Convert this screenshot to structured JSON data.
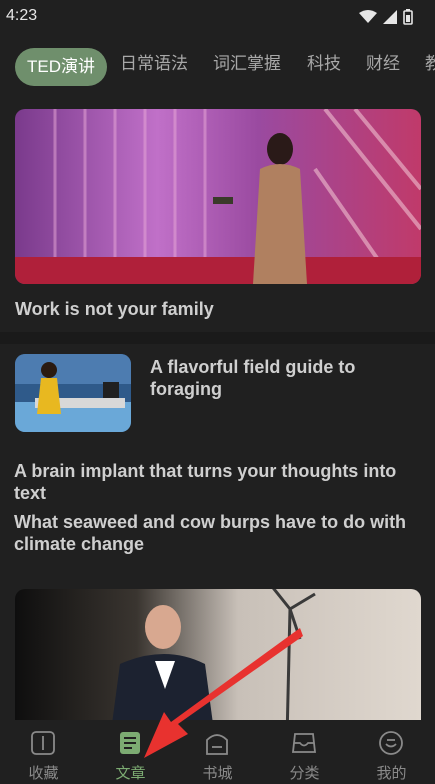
{
  "status": {
    "time": "4:23"
  },
  "tabs": [
    {
      "label": "TED演讲"
    },
    {
      "label": "日常语法"
    },
    {
      "label": "词汇掌握"
    },
    {
      "label": "科技"
    },
    {
      "label": "财经"
    },
    {
      "label": "教"
    }
  ],
  "articles": [
    {
      "title": "Work is not your family"
    },
    {
      "title": "A flavorful field guide to foraging"
    },
    {
      "title": "A brain implant that turns your thoughts into text"
    },
    {
      "title": "What seaweed and cow burps have to do with climate change"
    }
  ],
  "bottom_nav": [
    {
      "label": "收藏",
      "icon": "book-open-icon"
    },
    {
      "label": "文章",
      "icon": "article-icon"
    },
    {
      "label": "书城",
      "icon": "bookstore-icon"
    },
    {
      "label": "分类",
      "icon": "tray-icon"
    },
    {
      "label": "我的",
      "icon": "profile-icon"
    }
  ],
  "colors": {
    "accent": "#7cab72",
    "active_tab_bg": "#6f8f6c",
    "background": "#202020",
    "annotation_arrow": "#e8322f"
  }
}
